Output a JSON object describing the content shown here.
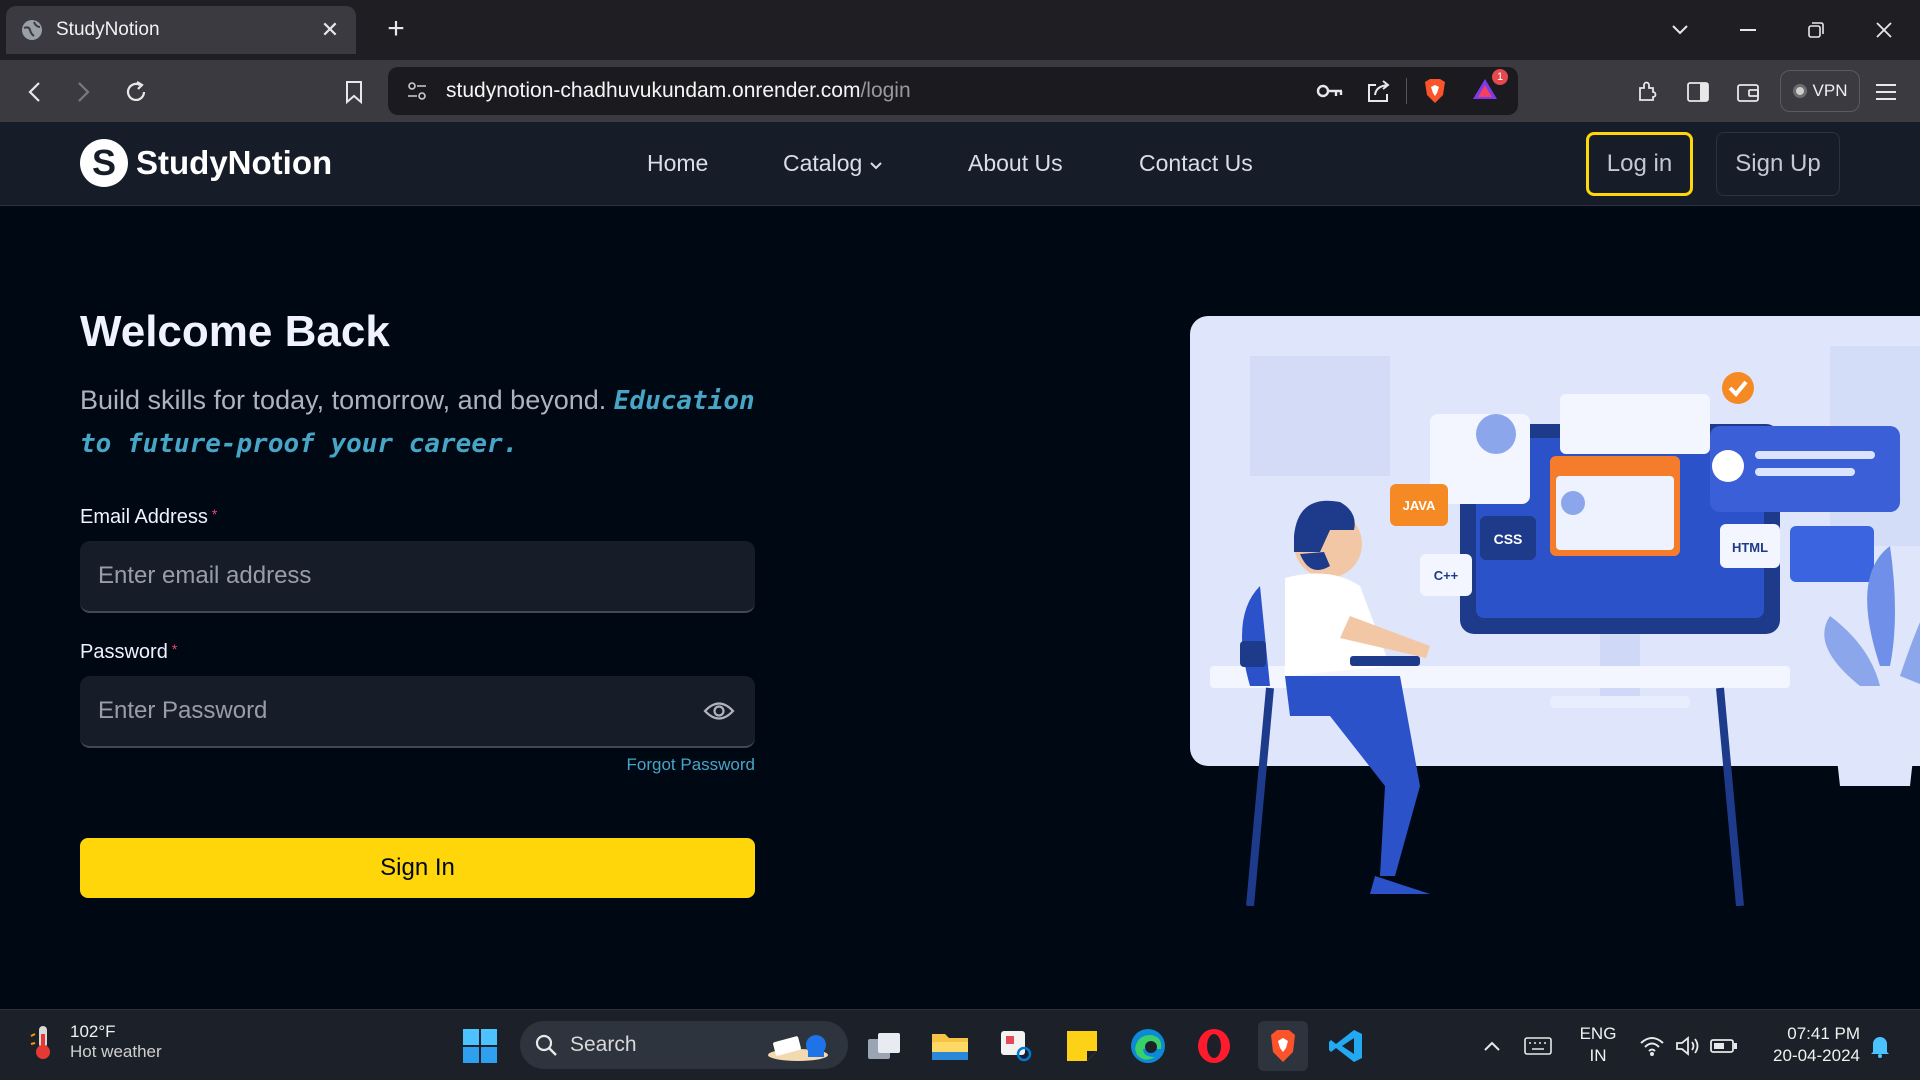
{
  "browser": {
    "tab_title": "StudyNotion",
    "url_host": "studynotion-chadhuvukundam.onrender.com",
    "url_path": "/login",
    "notification_count": "1",
    "vpn_label": "VPN"
  },
  "site_nav": {
    "logo_text": "StudyNotion",
    "logo_letter": "S",
    "links": [
      "Home",
      "Catalog",
      "About Us",
      "Contact Us"
    ],
    "login_label": "Log in",
    "signup_label": "Sign Up"
  },
  "login": {
    "heading": "Welcome Back",
    "subtitle": "Build skills for today, tomorrow, and beyond.",
    "subtitle_accent": "Education to future-proof your career.",
    "email_label": "Email Address",
    "email_placeholder": "Enter email address",
    "password_label": "Password",
    "password_placeholder": "Enter Password",
    "required_mark": "*",
    "forgot_label": "Forgot Password",
    "submit_label": "Sign In"
  },
  "illustration": {
    "tags": [
      "JAVA",
      "CSS",
      "C++",
      "HTML"
    ]
  },
  "taskbar": {
    "weather_temp": "102°F",
    "weather_desc": "Hot weather",
    "search_label": "Search",
    "lang_line1": "ENG",
    "lang_line2": "IN",
    "time": "07:41 PM",
    "date": "20-04-2024"
  },
  "colors": {
    "accent_yellow": "#FFD60A",
    "page_bg": "#000814",
    "nav_bg": "#161D29",
    "link_blue": "#47A5C5"
  }
}
